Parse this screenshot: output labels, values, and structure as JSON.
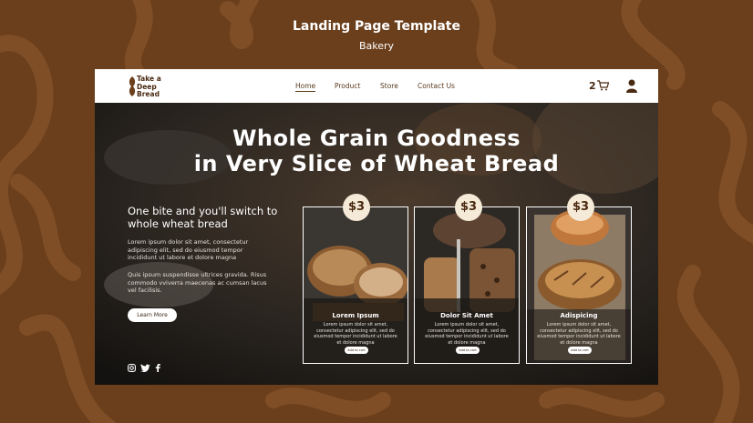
{
  "header": {
    "title": "Landing Page Template",
    "subtitle": "Bakery"
  },
  "brand": {
    "logo_line1": "Take a",
    "logo_line2": "Deep",
    "logo_line3": "Bread"
  },
  "nav": {
    "items": [
      "Home",
      "Product",
      "Store",
      "Contact Us"
    ],
    "active": "Home",
    "cart_count": "2"
  },
  "hero": {
    "title_line1": "Whole Grain Goodness",
    "title_line2": "in Very Slice of Wheat Bread",
    "sub_heading_line1": "One bite and you'll switch to",
    "sub_heading_line2": "whole wheat bread",
    "para1": "Lorem ipsum dolor sit amet, consectetur adipiscing elit, sed do eiusmod tempor incididunt ut labore et dolore magna",
    "para2": "Quis ipsum suspendisse ultrices gravida. Risus commodo vviverra maecenas ac cumsan lacus vel facilisis.",
    "cta": "Learn More"
  },
  "products": [
    {
      "price": "$3",
      "name": "Lorem Ipsum",
      "desc": "Lorem ipsum dolor sit amet, consectetur adipiscing elit, sed do eiusmod tempor incididunt ut labore et dolore magna",
      "button": "Add to cart"
    },
    {
      "price": "$3",
      "name": "Dolor Sit Amet",
      "desc": "Lorem ipsum dolor sit amet, consectetur adipiscing elit, sed do eiusmod tempor incididunt ut labore et dolore magna",
      "button": "Add to cart"
    },
    {
      "price": "$3",
      "name": "Adispicing",
      "desc": "Lorem ipsum dolor sit amet, consectetur adipiscing elit, sed do eiusmod tempor incididunt ut labore et dolore magna",
      "button": "Add to cart"
    }
  ],
  "social": [
    "instagram-icon",
    "twitter-icon",
    "facebook-icon"
  ],
  "colors": {
    "background": "#6b3f1c",
    "swirl": "#7d4c25",
    "accent": "#4a2a12",
    "badge": "#f5ead7"
  }
}
